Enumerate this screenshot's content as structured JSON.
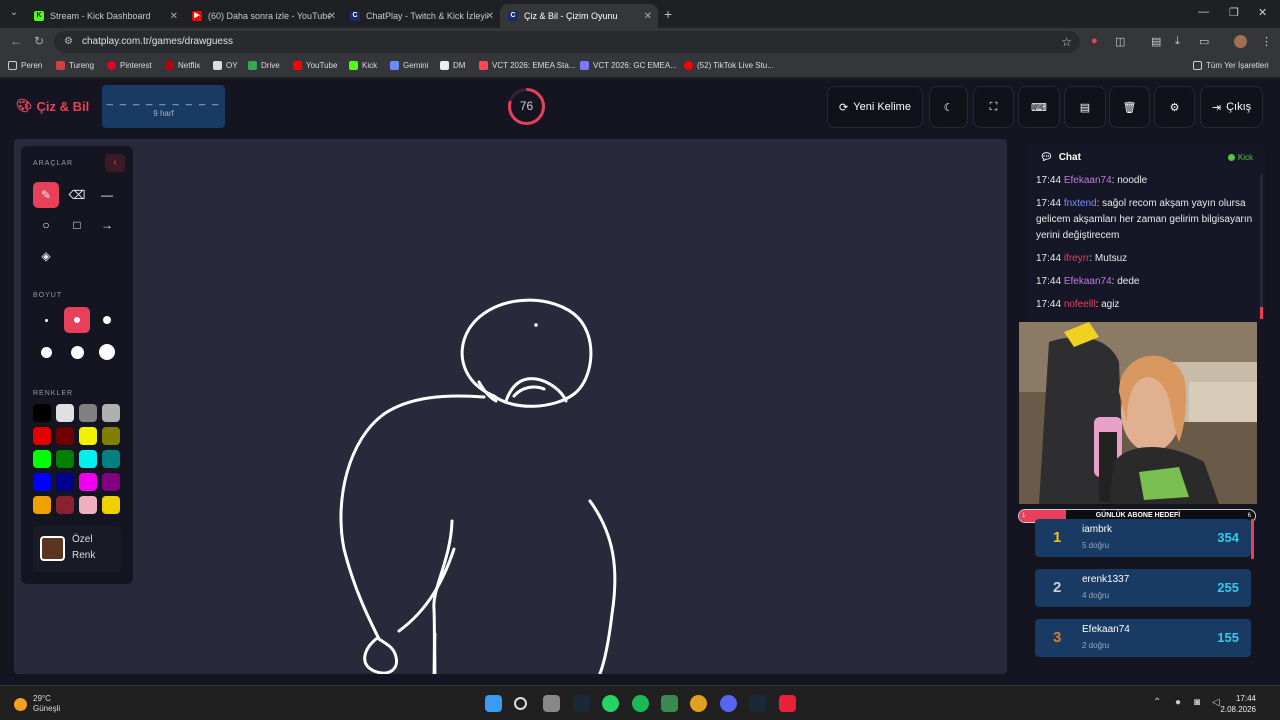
{
  "browser": {
    "tabs": [
      {
        "title": "Stream - Kick Dashboard",
        "color": "#53fc18"
      },
      {
        "title": "(60) Daha sonra izle - YouTube",
        "color": "#ff0000"
      },
      {
        "title": "ChatPlay - Twitch & Kick İzleyici",
        "color": "#1a2a6a"
      },
      {
        "title": "Çiz & Bil - Çizim Oyunu",
        "color": "#1a2a6a"
      }
    ],
    "url": "chatplay.com.tr/games/drawguess",
    "bookmarks": [
      "Peren",
      "Tureng",
      "Pinterest",
      "Netflix",
      "OY",
      "Drive",
      "YouTube",
      "Kick",
      "Gemini",
      "DM",
      "VCT 2026: EMEA Sta...",
      "VCT 2026: GC EMEA...",
      "(52) TikTok Live Stu..."
    ],
    "all_bookmarks": "Tüm Yer İşaretleri"
  },
  "header": {
    "logo": "Çiz & Bil",
    "word_mask": "_ _ _ _ _ _ _ _ _",
    "letter_count": "9 harf",
    "timer": "76",
    "timer_progress": 0.8,
    "new_word": "Yeni Kelime",
    "exit": "Çıkış"
  },
  "tools": {
    "tools_label": "ARAÇLAR",
    "size_label": "BOYUT",
    "colors_label": "RENKLER",
    "custom_color": "Özel Renk",
    "custom_color_value": "#5c3520",
    "palette": [
      "#000000",
      "#e0e0e0",
      "#808080",
      "#b0b0b0",
      "#e00000",
      "#700000",
      "#f0f000",
      "#808000",
      "#00ff00",
      "#008000",
      "#00f0f0",
      "#008080",
      "#0000ff",
      "#00008a",
      "#f000f0",
      "#800080",
      "#f0a000",
      "#8b2030",
      "#f0b0c0",
      "#f0d000"
    ]
  },
  "chat": {
    "title": "Chat",
    "platform": "Kick",
    "messages": [
      {
        "time": "17:44",
        "user": "Efekaan74",
        "color": "#c37ae0",
        "text": "noodle"
      },
      {
        "time": "17:44",
        "user": "fnxtend",
        "color": "#7a90ff",
        "text": "sağol recom akşam yayın olursa gelicem akşamları her zaman gelirim bilgisayarın yerini değiştirecem"
      },
      {
        "time": "17:44",
        "user": "ifreyrr",
        "color": "#e04060",
        "text": "Mutsuz"
      },
      {
        "time": "17:44",
        "user": "Efekaan74",
        "color": "#c37ae0",
        "text": "dede"
      },
      {
        "time": "17:44",
        "user": "nofeelll",
        "color": "#e04060",
        "text": "agiz"
      }
    ]
  },
  "goal": {
    "label": "GÜNLÜK ABONE HEDEFİ",
    "current": "1",
    "target": "6",
    "progress": 0.2
  },
  "leaderboard": [
    {
      "rank": "1",
      "name": "iambrk",
      "correct": "5 doğru",
      "score": "354",
      "color": "#f0c020"
    },
    {
      "rank": "2",
      "name": "erenk1337",
      "correct": "4 doğru",
      "score": "255",
      "color": "#c8d0e0"
    },
    {
      "rank": "3",
      "name": "Efekaan74",
      "correct": "2 doğru",
      "score": "155",
      "color": "#d08030"
    }
  ],
  "taskbar": {
    "temp": "29°C",
    "weather": "Güneşli",
    "time": "17:44",
    "date": "2.08.2026"
  }
}
